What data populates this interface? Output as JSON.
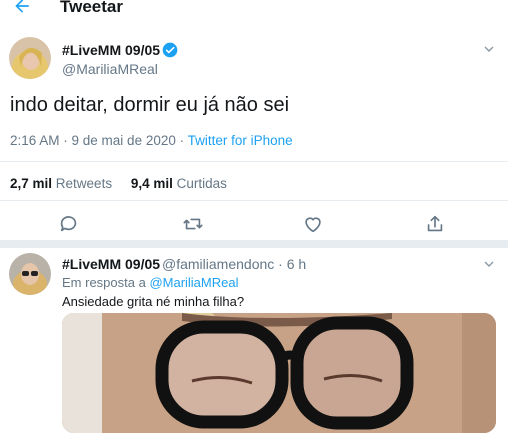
{
  "header": {
    "title": "Tweetar",
    "back_icon": "arrow-left-icon",
    "accent": "#1da1f2"
  },
  "tweet": {
    "display_name": "#LiveMM 09/05",
    "handle": "@MariliaMReal",
    "verified": true,
    "text": "indo deitar, dormir eu já não sei",
    "time_date": "2:16 AM · 9 de mai de 2020 · ",
    "source": "Twitter for iPhone",
    "retweets_count": "2,7 mil",
    "retweets_label": "Retweets",
    "likes_count": "9,4 mil",
    "likes_label": "Curtidas",
    "actions": [
      "reply-icon",
      "retweet-icon",
      "like-icon",
      "share-icon"
    ]
  },
  "reply": {
    "display_name": "#LiveMM 09/05",
    "handle_time": "@familiamendonc · 6 h",
    "reply_prefix": "Em resposta a ",
    "reply_to": "@MariliaMReal",
    "text": "Ansiedade grita né minha filha?"
  }
}
